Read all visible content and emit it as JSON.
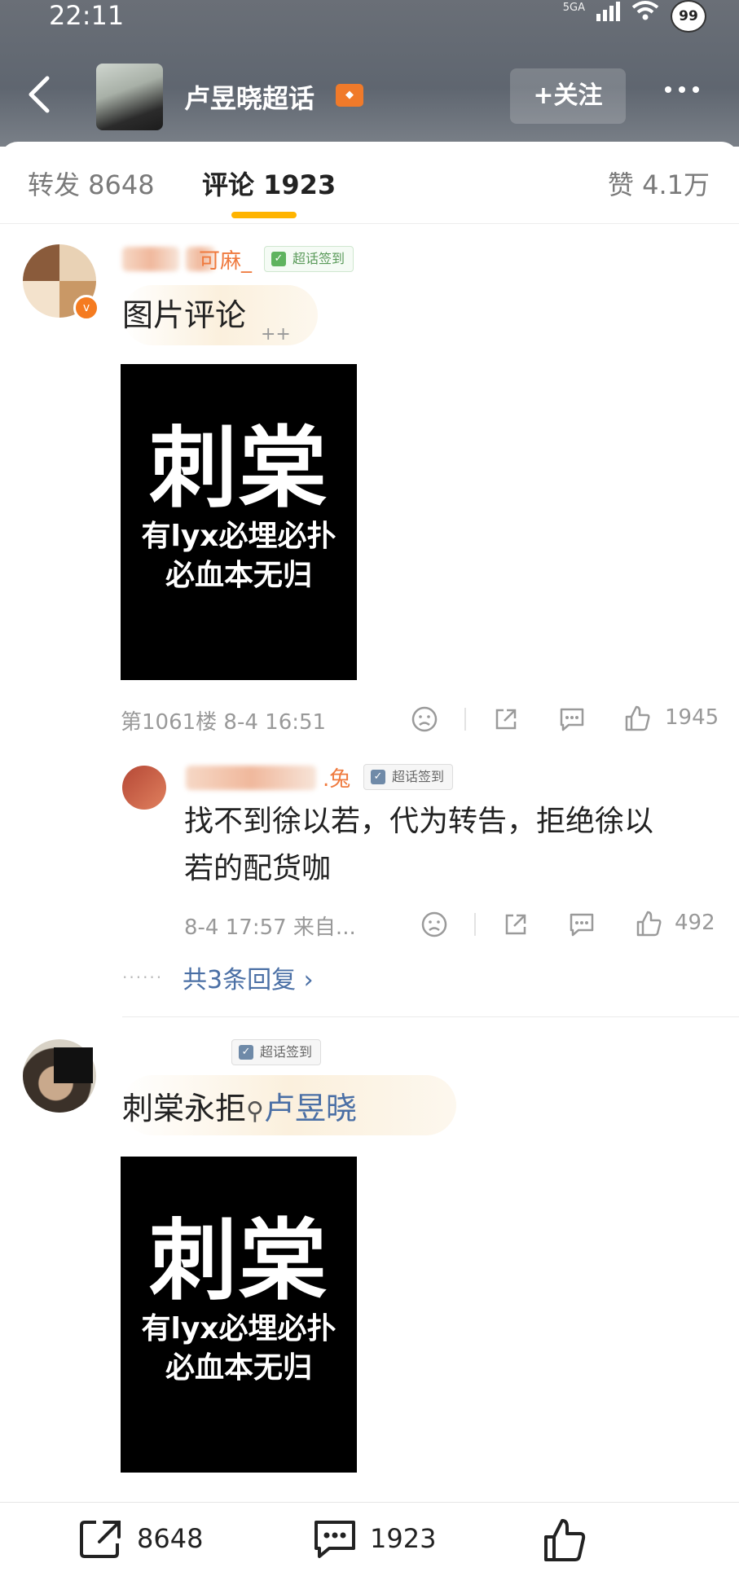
{
  "status": {
    "time": "22:11",
    "network": "5GA",
    "battery_badge": "99"
  },
  "header": {
    "topic_title": "卢昱晓超话",
    "follow_label": "+关注"
  },
  "tabs": {
    "repost": "转发 8648",
    "comment": "评论 1923",
    "like": "赞 4.1万"
  },
  "comments": [
    {
      "username_tail": "可麻_",
      "sign_tag": "超话签到",
      "text": "图片评论",
      "deco": "++",
      "image": {
        "big": "刺棠",
        "line1": "有lyx必埋必扑",
        "line2": "必血本无归"
      },
      "meta": "第1061楼 8-4 16:51",
      "likes": "1945",
      "reply": {
        "username_tail": ".兔",
        "sign_tag": "超话签到",
        "text_line1": "找不到徐以若，代为转告，拒绝徐以",
        "text_line2": "若的配货咖",
        "meta": "8-4 17:57 来自...",
        "likes": "492"
      },
      "more_replies": "共3条回复 ›"
    },
    {
      "sign_tag": "超话签到",
      "text": "刺棠永拒",
      "search_link": "卢昱晓",
      "image": {
        "big": "刺棠",
        "line1": "有lyx必埋必扑",
        "line2": "必血本无归"
      }
    }
  ],
  "bottom_bar": {
    "repost_count": "8648",
    "comment_count": "1923"
  },
  "colors": {
    "accent": "#ffb400",
    "link": "#4a6fa5",
    "orange": "#f57b20"
  }
}
